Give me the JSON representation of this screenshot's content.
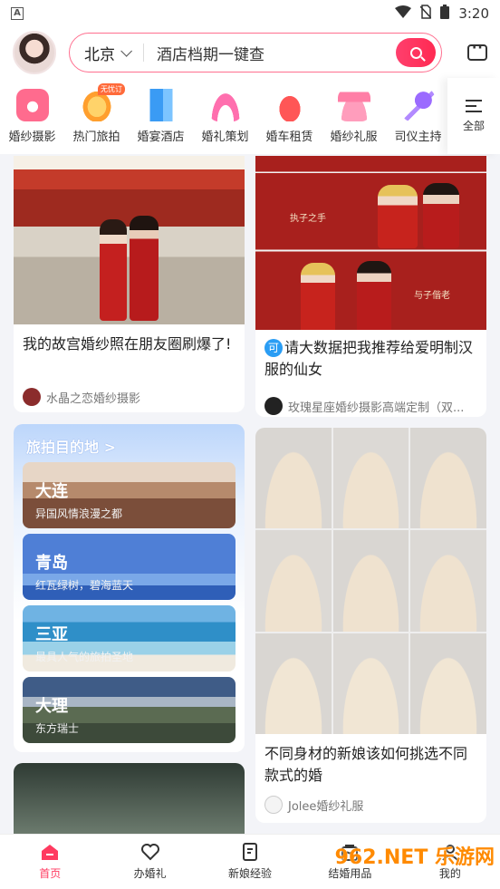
{
  "status_bar": {
    "carrier_badge": "A",
    "time": "3:20"
  },
  "header": {
    "city": "北京",
    "search_placeholder": "酒店档期一键查"
  },
  "categories": [
    {
      "label": "婚纱摄影",
      "icon": "camera-icon",
      "color": "#ff6b8e"
    },
    {
      "label": "热门旅拍",
      "icon": "lantern-icon",
      "color": "#ffb23a",
      "badge": "无忧订"
    },
    {
      "label": "婚宴酒店",
      "icon": "hotel-icon",
      "color": "#3a9bf4"
    },
    {
      "label": "婚礼策划",
      "icon": "arch-icon",
      "color": "#ff6fae"
    },
    {
      "label": "婚车租赁",
      "icon": "car-icon",
      "color": "#ff5656"
    },
    {
      "label": "婚纱礼服",
      "icon": "dress-icon",
      "color": "#ff7ea6"
    },
    {
      "label": "司仪主持",
      "icon": "microphone-icon",
      "color": "#9b6bff"
    }
  ],
  "all_label": "全部",
  "feed": {
    "card1": {
      "title": "我的故宫婚纱照在朋友圈刷爆了!",
      "author": "水晶之恋婚纱摄影"
    },
    "card2": {
      "tag": "可",
      "title": "请大数据把我推荐给爱明制汉服的仙女",
      "author": "玫瑰星座婚纱摄影高端定制（双..."
    },
    "card3": {
      "title": "不同身材的新娘该如何挑选不同款式的婚",
      "author": "Jolee婚纱礼服"
    },
    "photo_text": {
      "left": "执子之手",
      "right": "与子偕老"
    }
  },
  "travel": {
    "header": "旅拍目的地 >",
    "destinations": [
      {
        "name": "大连",
        "sub": "异国风情浪漫之都"
      },
      {
        "name": "青岛",
        "sub": "红瓦绿树，碧海蓝天"
      },
      {
        "name": "三亚",
        "sub": "最具人气的旅拍圣地"
      },
      {
        "name": "大理",
        "sub": "东方瑞士"
      }
    ]
  },
  "tabbar": [
    {
      "label": "首页",
      "icon": "home-icon",
      "active": true
    },
    {
      "label": "办婚礼",
      "icon": "heart-icon",
      "active": false
    },
    {
      "label": "新娘经验",
      "icon": "note-icon",
      "active": false
    },
    {
      "label": "结婚用品",
      "icon": "bag-icon",
      "active": false
    },
    {
      "label": "我的",
      "icon": "profile-icon",
      "active": false
    }
  ],
  "watermark": "962.NET 乐游网"
}
